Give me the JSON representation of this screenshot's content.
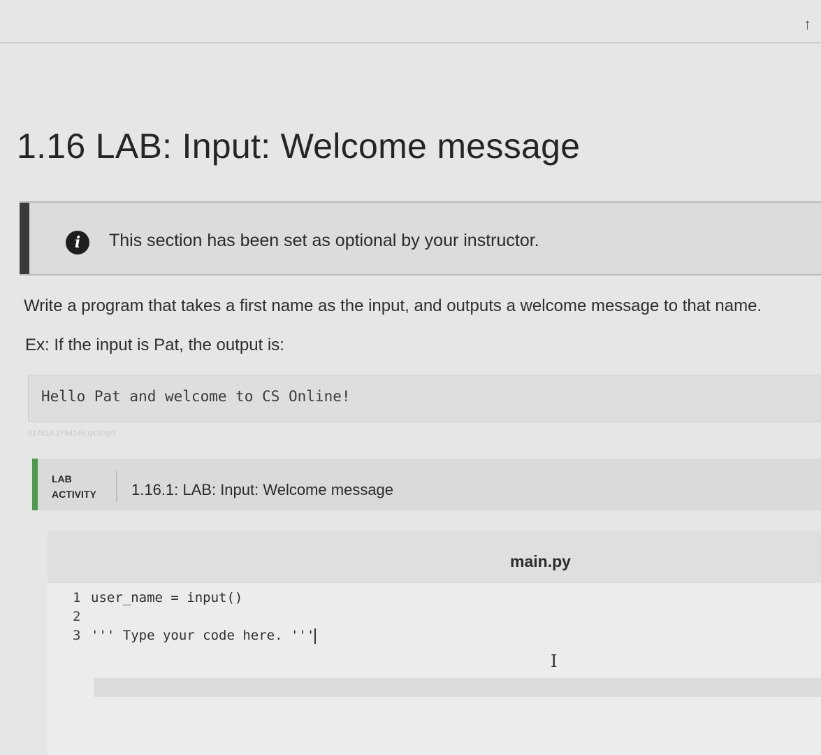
{
  "page": {
    "title": "1.16 LAB: Input: Welcome message"
  },
  "notice": {
    "icon": "info-icon",
    "text": "This section has been set as optional by your instructor."
  },
  "content": {
    "instructions": "Write a program that takes a first name as the input, and outputs a welcome message to that name.",
    "example_intro": "Ex: If the input is Pat, the output is:",
    "example_output": "Hello Pat and welcome to CS Online!",
    "lab_id": "417514.2764146.qx3zqy7"
  },
  "lab": {
    "tag_line1": "LAB",
    "tag_line2": "ACTIVITY",
    "title": "1.16.1: LAB: Input: Welcome message",
    "accent_color": "#4c9a4c"
  },
  "editor": {
    "file_name": "main.py",
    "lines": [
      {
        "num": "1",
        "code": "user_name = input()"
      },
      {
        "num": "2",
        "code": ""
      },
      {
        "num": "3",
        "code": "''' Type your code here. '''"
      }
    ]
  }
}
